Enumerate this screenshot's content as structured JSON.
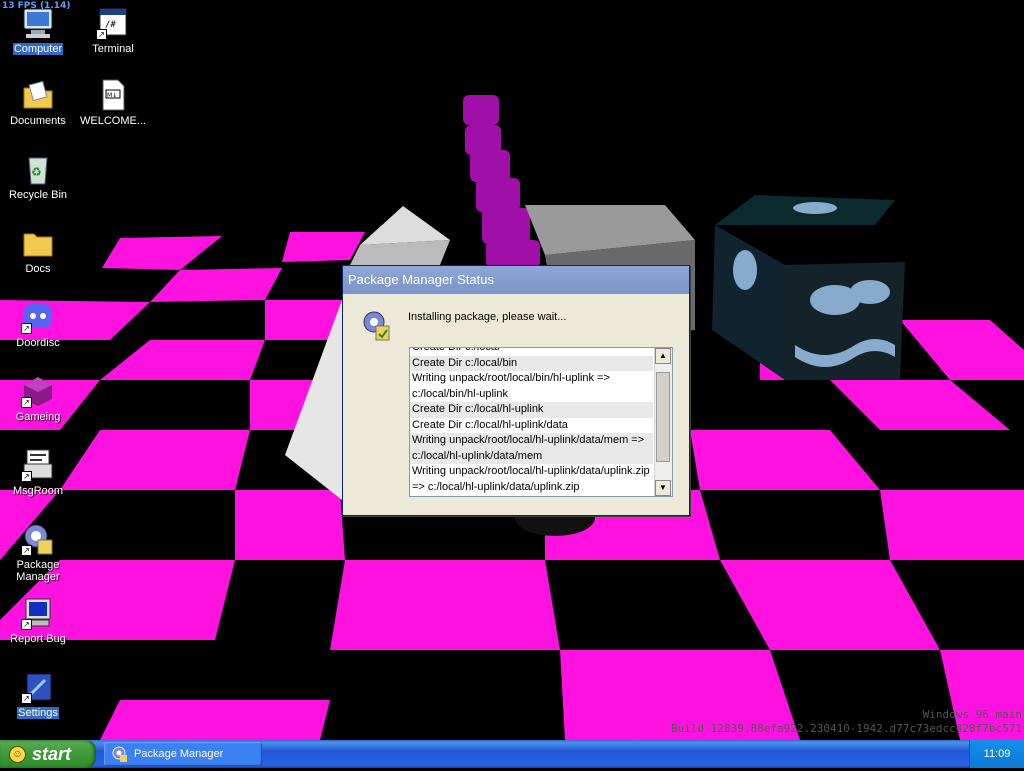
{
  "overlay": {
    "fps": "13 FPS (1.14)",
    "build_line1": "Windows 96 main",
    "build_line2": "Build 12839.88efa922.230410-1942.d77c73edcc428f7bc571"
  },
  "desktop_icons": [
    {
      "label": "Computer",
      "icon": "computer-icon",
      "selected": true
    },
    {
      "label": "Terminal",
      "icon": "terminal-icon"
    },
    {
      "label": "Documents",
      "icon": "documents-folder-icon"
    },
    {
      "label": "WELCOME...",
      "icon": "markdown-file-icon"
    },
    {
      "label": "Recycle Bin",
      "icon": "recycle-bin-icon"
    },
    {
      "label": "Docs",
      "icon": "folder-icon"
    },
    {
      "label": "Doordisc",
      "icon": "doordisc-icon"
    },
    {
      "label": "Gameing",
      "icon": "game-icon"
    },
    {
      "label": "MsgRoom",
      "icon": "msgroom-icon"
    },
    {
      "label": "Package Manager",
      "icon": "package-manager-icon"
    },
    {
      "label": "Report Bug",
      "icon": "report-bug-icon"
    },
    {
      "label": "Settings",
      "icon": "settings-icon",
      "selected": true
    }
  ],
  "dialog": {
    "title": "Package Manager Status",
    "message": "Installing package, please wait...",
    "log": [
      "Create Dir c:/local",
      "Create Dir c:/local/bin",
      "Writing unpack/root/local/bin/hl-uplink =>",
      "c:/local/bin/hl-uplink",
      "Create Dir c:/local/hl-uplink",
      "Create Dir c:/local/hl-uplink/data",
      "Writing unpack/root/local/hl-uplink/data/mem =>",
      "c:/local/hl-uplink/data/mem",
      "Writing unpack/root/local/hl-uplink/data/uplink.zip",
      "=> c:/local/hl-uplink/data/uplink.zip"
    ]
  },
  "taskbar": {
    "start_label": "start",
    "task_label": "Package Manager",
    "clock": "11:09"
  }
}
